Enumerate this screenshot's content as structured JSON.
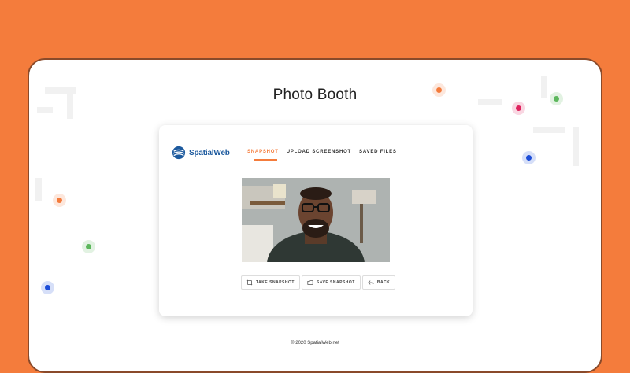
{
  "page": {
    "title": "Photo Booth",
    "footer": "© 2020 SpatialWeb.net"
  },
  "brand": {
    "name": "SpatialWeb",
    "accent_color": "#f47c3c",
    "logo_color": "#1d5a9e"
  },
  "nav": {
    "items": [
      {
        "label": "SNAPSHOT",
        "active": true
      },
      {
        "label": "UPLOAD SCREENSHOT",
        "active": false
      },
      {
        "label": "SAVED FILES",
        "active": false
      }
    ]
  },
  "photo": {
    "icon": "webcam-snapshot-photo"
  },
  "actions": {
    "take_snapshot": "TAKE SNAPSHOT",
    "save_snapshot": "SAVE SNAPSHOT",
    "back": "BACK"
  },
  "colors": {
    "background": "#f47c3c",
    "screen": "#ffffff"
  }
}
